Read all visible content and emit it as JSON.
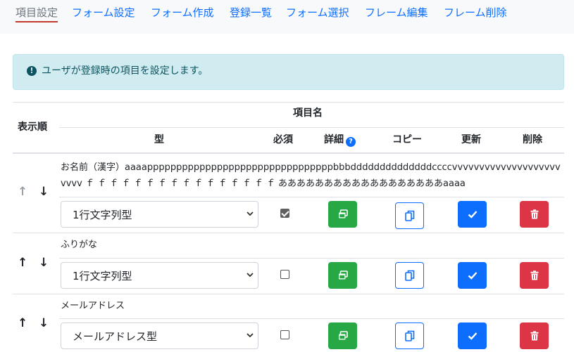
{
  "tabs": [
    {
      "label": "項目設定",
      "active": true
    },
    {
      "label": "フォーム設定"
    },
    {
      "label": "フォーム作成"
    },
    {
      "label": "登録一覧"
    },
    {
      "label": "フォーム選択"
    },
    {
      "label": "フレーム編集"
    },
    {
      "label": "フレーム削除"
    }
  ],
  "alert": {
    "icon": "exclamation-circle-icon",
    "text": "ユーザが登録時の項目を設定します。"
  },
  "table": {
    "header_order": "表示順",
    "header_item_name": "項目名",
    "header_type": "型",
    "header_required": "必須",
    "header_detail": "詳細",
    "header_copy": "コピー",
    "header_update": "更新",
    "header_delete": "削除"
  },
  "rows": [
    {
      "label": "お名前（漢字）aaaappppppppppppppppppppppppppppppppbbbddddddddddddddccccvvvvvvvvvvvvvvvvvvvvvvvv ｆ ｆ ｆ ｆ ｆ ｆ ｆ ｆ ｆ ｆ ｆ ｆ ｆ ｆ ｆ ｆ ああああああああああああああああああaaaa",
      "type": "1行文字列型",
      "required": true
    },
    {
      "label": "ふりがな",
      "type": "1行文字列型",
      "required": false
    },
    {
      "label": "メールアドレス",
      "type": "メールアドレス型",
      "required": false
    }
  ]
}
